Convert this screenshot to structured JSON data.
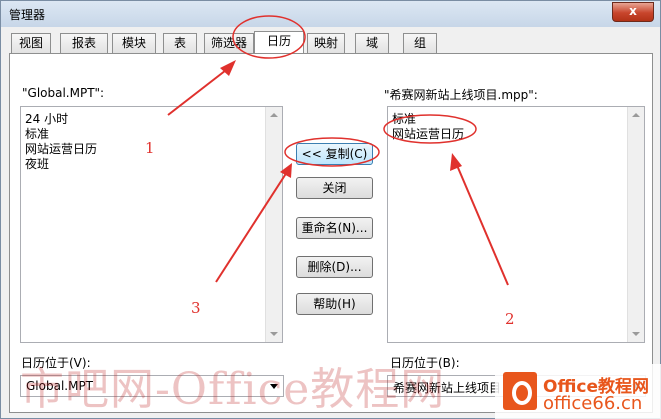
{
  "window": {
    "title": "管理器",
    "close_label": "x"
  },
  "tabs": [
    "视图",
    "报表",
    "模块",
    "表",
    "筛选器",
    "日历",
    "映射",
    "域",
    "组"
  ],
  "active_tab_index": 5,
  "left_panel": {
    "label": "\"Global.MPT\":",
    "items": [
      "24 小时",
      "标准",
      "网站运营日历",
      "夜班"
    ],
    "location_label": "日历位于(V):",
    "location_value": "Global.MPT"
  },
  "right_panel": {
    "label": "\"希赛网新站上线项目.mpp\":",
    "items": [
      "标准",
      "网站运营日历"
    ],
    "location_label": "日历位于(B):",
    "location_value": "希赛网新站上线项目"
  },
  "buttons": {
    "copy": "<< 复制(C)",
    "close": "关闭",
    "rename": "重命名(N)...",
    "delete": "删除(D)...",
    "help": "帮助(H)"
  },
  "annotations": {
    "n1": "1",
    "n2": "2",
    "n3": "3",
    "annotation_color": "#e0312d"
  },
  "watermark": {
    "text": "市吧网-Office教程网",
    "logo_line1": "Office教程网",
    "logo_line2": "office66.cn",
    "logo_color": "#e8561c"
  }
}
